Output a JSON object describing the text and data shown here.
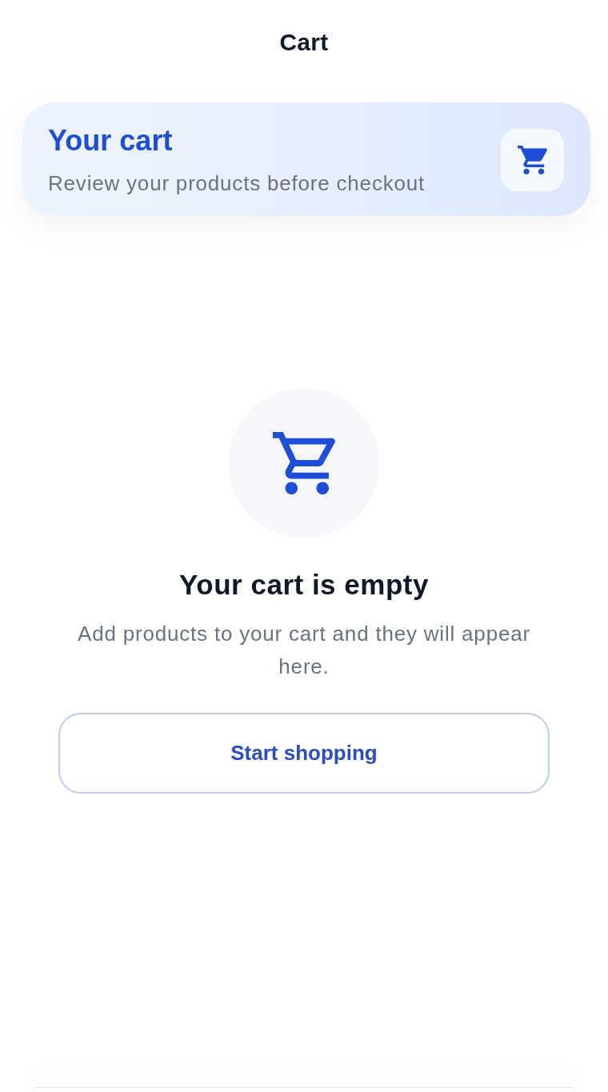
{
  "app_bar": {
    "title": "Cart"
  },
  "header_card": {
    "title": "Your cart",
    "subtitle": "Review your products before checkout"
  },
  "empty_state": {
    "title": "Your cart is empty",
    "message": "Add products to your cart and they will appear here.",
    "button": "Start shopping"
  }
}
